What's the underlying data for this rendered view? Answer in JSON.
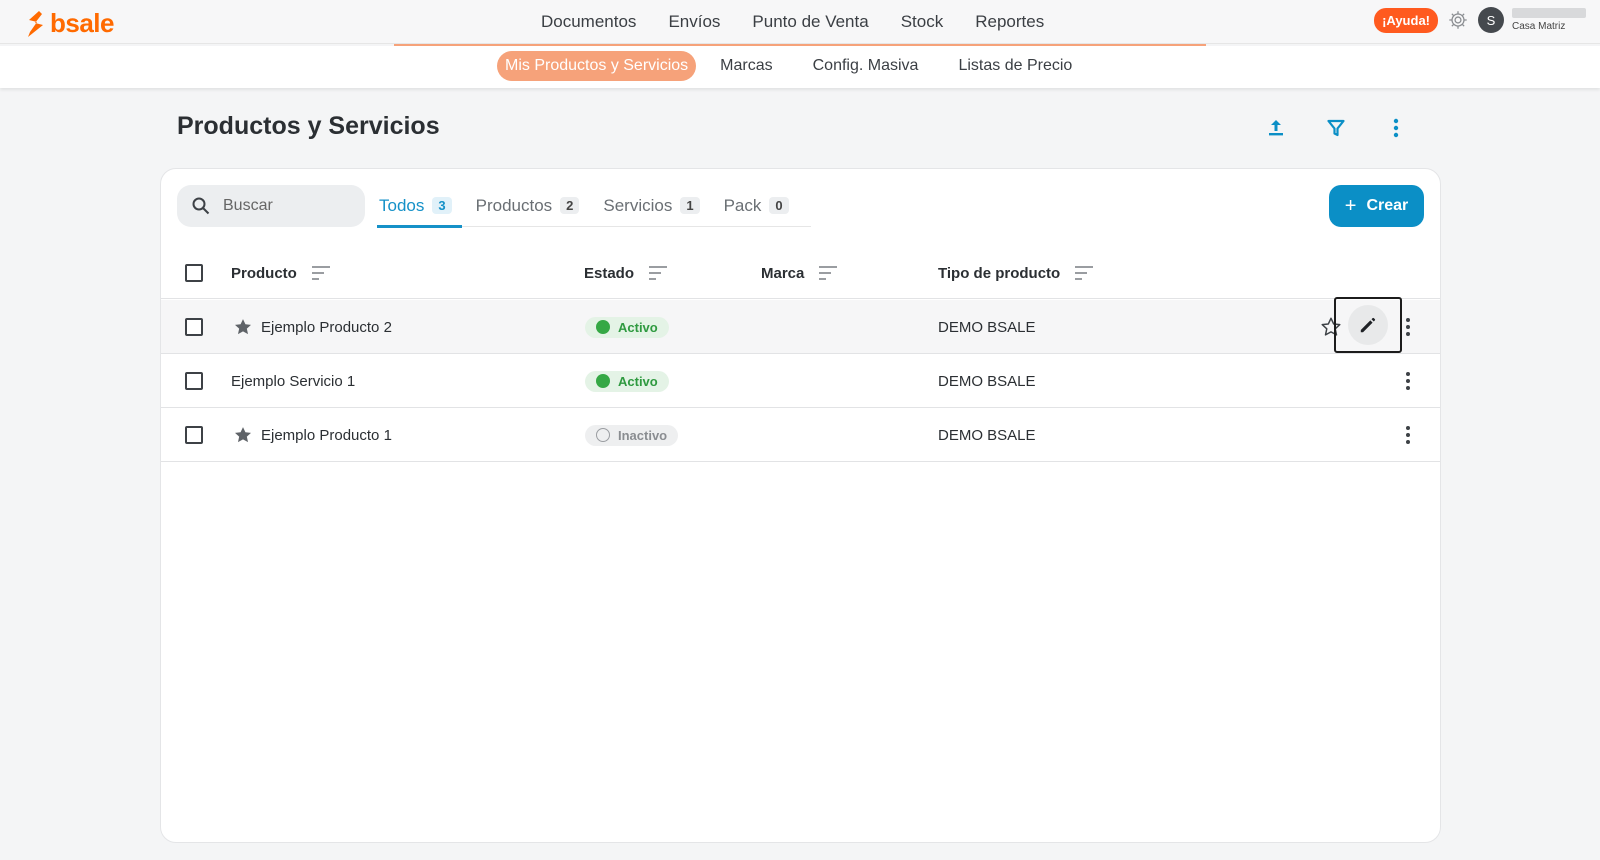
{
  "brand": {
    "name": "bsale",
    "color": "#ff6a00"
  },
  "main_nav": [
    "Documentos",
    "Envíos",
    "Punto de Venta",
    "Stock",
    "Reportes"
  ],
  "top_right": {
    "help_label": "¡Ayuda!",
    "avatar_initial": "S",
    "branch": "Casa Matriz"
  },
  "sub_nav": {
    "items": [
      "Mis Productos y Servicios",
      "Marcas",
      "Config. Masiva",
      "Listas de Precio"
    ],
    "active_index": 0
  },
  "page": {
    "title": "Productos y Servicios"
  },
  "search": {
    "placeholder": "Buscar"
  },
  "tabs": [
    {
      "label": "Todos",
      "count": "3",
      "active": true
    },
    {
      "label": "Productos",
      "count": "2"
    },
    {
      "label": "Servicios",
      "count": "1"
    },
    {
      "label": "Pack",
      "count": "0"
    }
  ],
  "create_button": {
    "label": "Crear"
  },
  "table": {
    "columns": [
      "Producto",
      "Estado",
      "Marca",
      "Tipo de producto"
    ],
    "rows": [
      {
        "name": "Ejemplo Producto 2",
        "starred": true,
        "status": "Activo",
        "brand": "",
        "type": "DEMO BSALE"
      },
      {
        "name": "Ejemplo Servicio 1",
        "starred": false,
        "status": "Activo",
        "brand": "",
        "type": "DEMO BSALE"
      },
      {
        "name": "Ejemplo Producto 1",
        "starred": true,
        "status": "Inactivo",
        "brand": "",
        "type": "DEMO BSALE"
      }
    ]
  },
  "colors": {
    "accent": "#0b8fc6",
    "brand_orange": "#ff6a00",
    "active_green": "#35a845"
  }
}
